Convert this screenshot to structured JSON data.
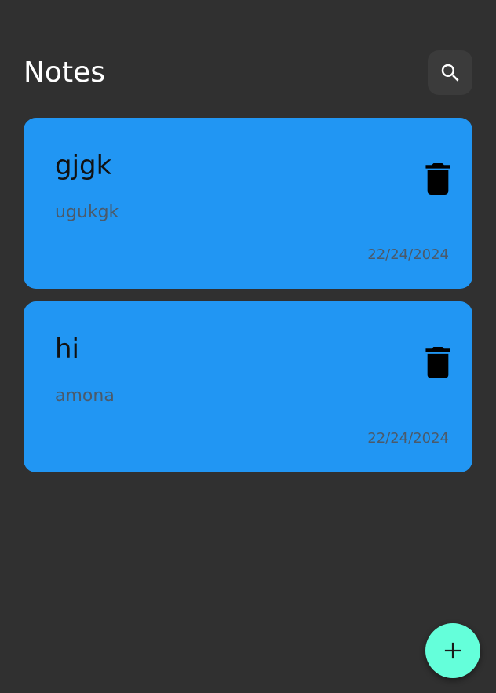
{
  "header": {
    "title": "Notes",
    "search_icon": "search-icon"
  },
  "notes": [
    {
      "title": "gjgk",
      "body": "ugukgk",
      "date": "22/24/2024",
      "delete_icon": "trash-icon"
    },
    {
      "title": "hi",
      "body": "amona",
      "date": "22/24/2024",
      "delete_icon": "trash-icon"
    }
  ],
  "fab": {
    "icon": "plus-icon"
  },
  "colors": {
    "background": "#303030",
    "card": "#2196f3",
    "search_button": "#3b3b3b",
    "fab": "#64ffda",
    "note_title": "#111111",
    "note_secondary": "#4b5a6a"
  }
}
